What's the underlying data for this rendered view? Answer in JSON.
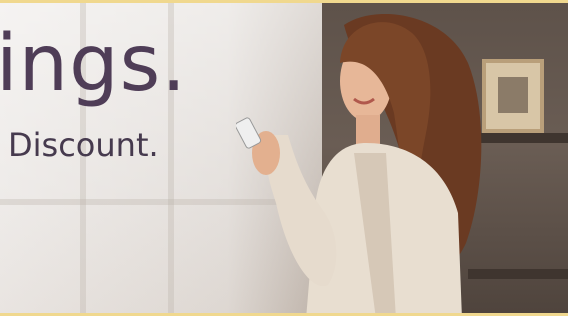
{
  "banner": {
    "headline": "ings.",
    "subline": "Discount."
  },
  "colors": {
    "headline": "#4f3d57",
    "border": "#f0d88e"
  }
}
